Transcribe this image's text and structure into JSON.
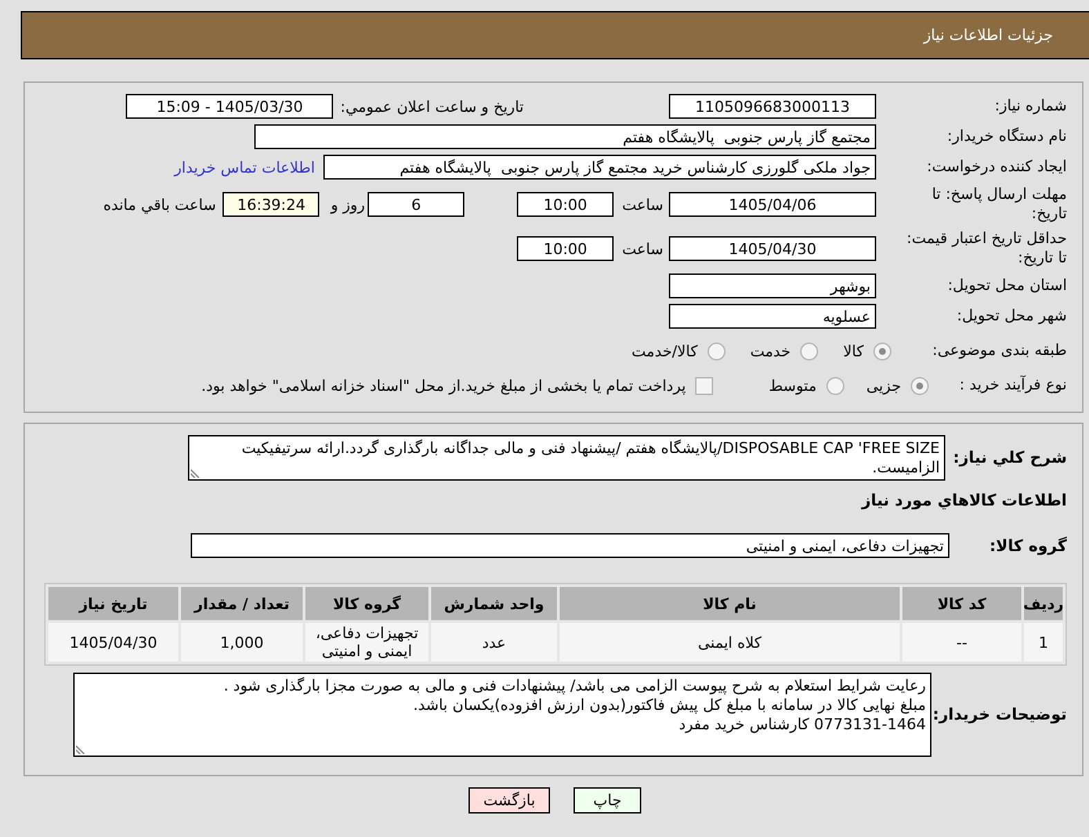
{
  "header": {
    "title": "جزئیات اطلاعات نیاز"
  },
  "details": {
    "need_number": {
      "label": "شماره نیاز:",
      "value": "1105096683000113"
    },
    "announcement": {
      "label": "تاریخ و ساعت اعلان عمومي:",
      "value": "1405/03/30 - 15:09"
    },
    "buyer_org": {
      "label": "نام دستگاه خریدار:",
      "value": "مجتمع گاز پارس جنوبی  پالایشگاه هفتم"
    },
    "requester": {
      "label": "ایجاد کننده درخواست:",
      "value": "جواد ملکی گلورزی کارشناس خرید مجتمع گاز پارس جنوبی  پالایشگاه هفتم",
      "link": "اطلاعات تماس خریدار"
    },
    "response_deadline": {
      "label": "مهلت ارسال پاسخ: تا تاریخ:",
      "date": "1405/04/06",
      "time_label": "ساعت",
      "time": "10:00",
      "days": "6",
      "days_label": "روز و",
      "remaining": "16:39:24",
      "remaining_label": "ساعت باقي مانده"
    },
    "price_validity": {
      "label": "حداقل تاریخ اعتبار قیمت: تا تاریخ:",
      "date": "1405/04/30",
      "time_label": "ساعت",
      "time": "10:00"
    },
    "province": {
      "label": "استان محل تحویل:",
      "value": "بوشهر"
    },
    "city": {
      "label": "شهر محل تحویل:",
      "value": "عسلویه"
    },
    "category": {
      "label": "طبقه بندی موضوعی:",
      "options": [
        {
          "label": "کالا",
          "selected": true
        },
        {
          "label": "خدمت",
          "selected": false
        },
        {
          "label": "کالا/خدمت",
          "selected": false
        }
      ]
    },
    "process": {
      "label": "نوع فرآیند خرید :",
      "options": [
        {
          "label": "جزیی",
          "selected": true
        },
        {
          "label": "متوسط",
          "selected": false
        }
      ],
      "treasury": {
        "label": "پرداخت تمام یا بخشی از مبلغ خرید.از محل \"اسناد خزانه اسلامی\" خواهد بود.",
        "checked": false
      }
    }
  },
  "description": {
    "label": "شرح کلي نیاز:",
    "value": "DISPOSABLE CAP 'FREE SIZE/پالایشگاه هفتم /پیشنهاد فنی و مالی جداگانه بارگذاری گردد.ارائه سرتیفیکیت الزامیست."
  },
  "goods": {
    "title": "اطلاعات کالاهاي مورد نیاز",
    "group_label": "گروه کالا:",
    "group": "تجهیزات دفاعی، ایمنی و امنیتی",
    "table": {
      "columns": [
        "ردیف",
        "کد کالا",
        "نام کالا",
        "واحد شمارش",
        "گروه کالا",
        "تعداد / مقدار",
        "تاریخ نیاز"
      ],
      "rows": [
        [
          "1",
          "--",
          "کلاه ایمنی",
          "عدد",
          "تجهیزات دفاعی، ایمنی و امنیتی",
          "1,000",
          "1405/04/30"
        ]
      ]
    }
  },
  "buyer_notes": {
    "label": "توضیحات خریدار:",
    "value": "رعایت شرایط استعلام به شرح پیوست الزامی می باشد/ پیشنهادات فنی و مالی به صورت مجزا بارگذاری شود .\nمبلغ نهایی کالا در سامانه با مبلغ کل پیش فاکتور(بدون ارزش افزوده)یکسان باشد.\n0773131-1464 کارشناس خرید مفرد"
  },
  "buttons": [
    {
      "label": "چاپ",
      "kind": "print"
    },
    {
      "label": "بازگشت",
      "kind": "back"
    }
  ]
}
